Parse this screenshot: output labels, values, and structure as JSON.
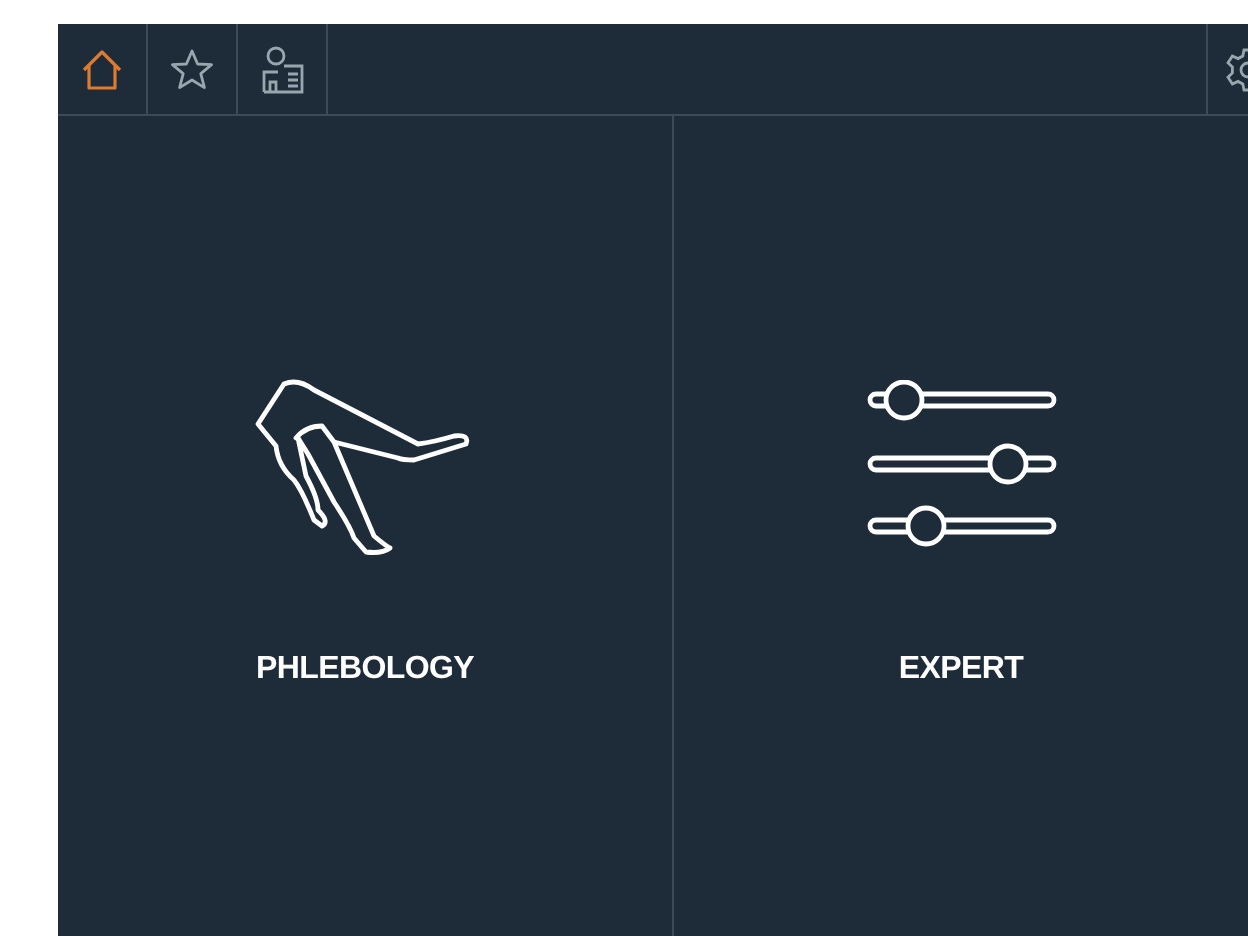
{
  "toolbar": {
    "tabs": [
      {
        "kind": "home",
        "selected": true
      },
      {
        "kind": "star",
        "selected": false
      },
      {
        "kind": "profile",
        "selected": false
      }
    ],
    "settings": {
      "kind": "gear"
    }
  },
  "tiles": [
    {
      "kind": "legs",
      "label": "PHLEBOLOGY"
    },
    {
      "kind": "sliders",
      "label": "EXPERT"
    }
  ]
}
